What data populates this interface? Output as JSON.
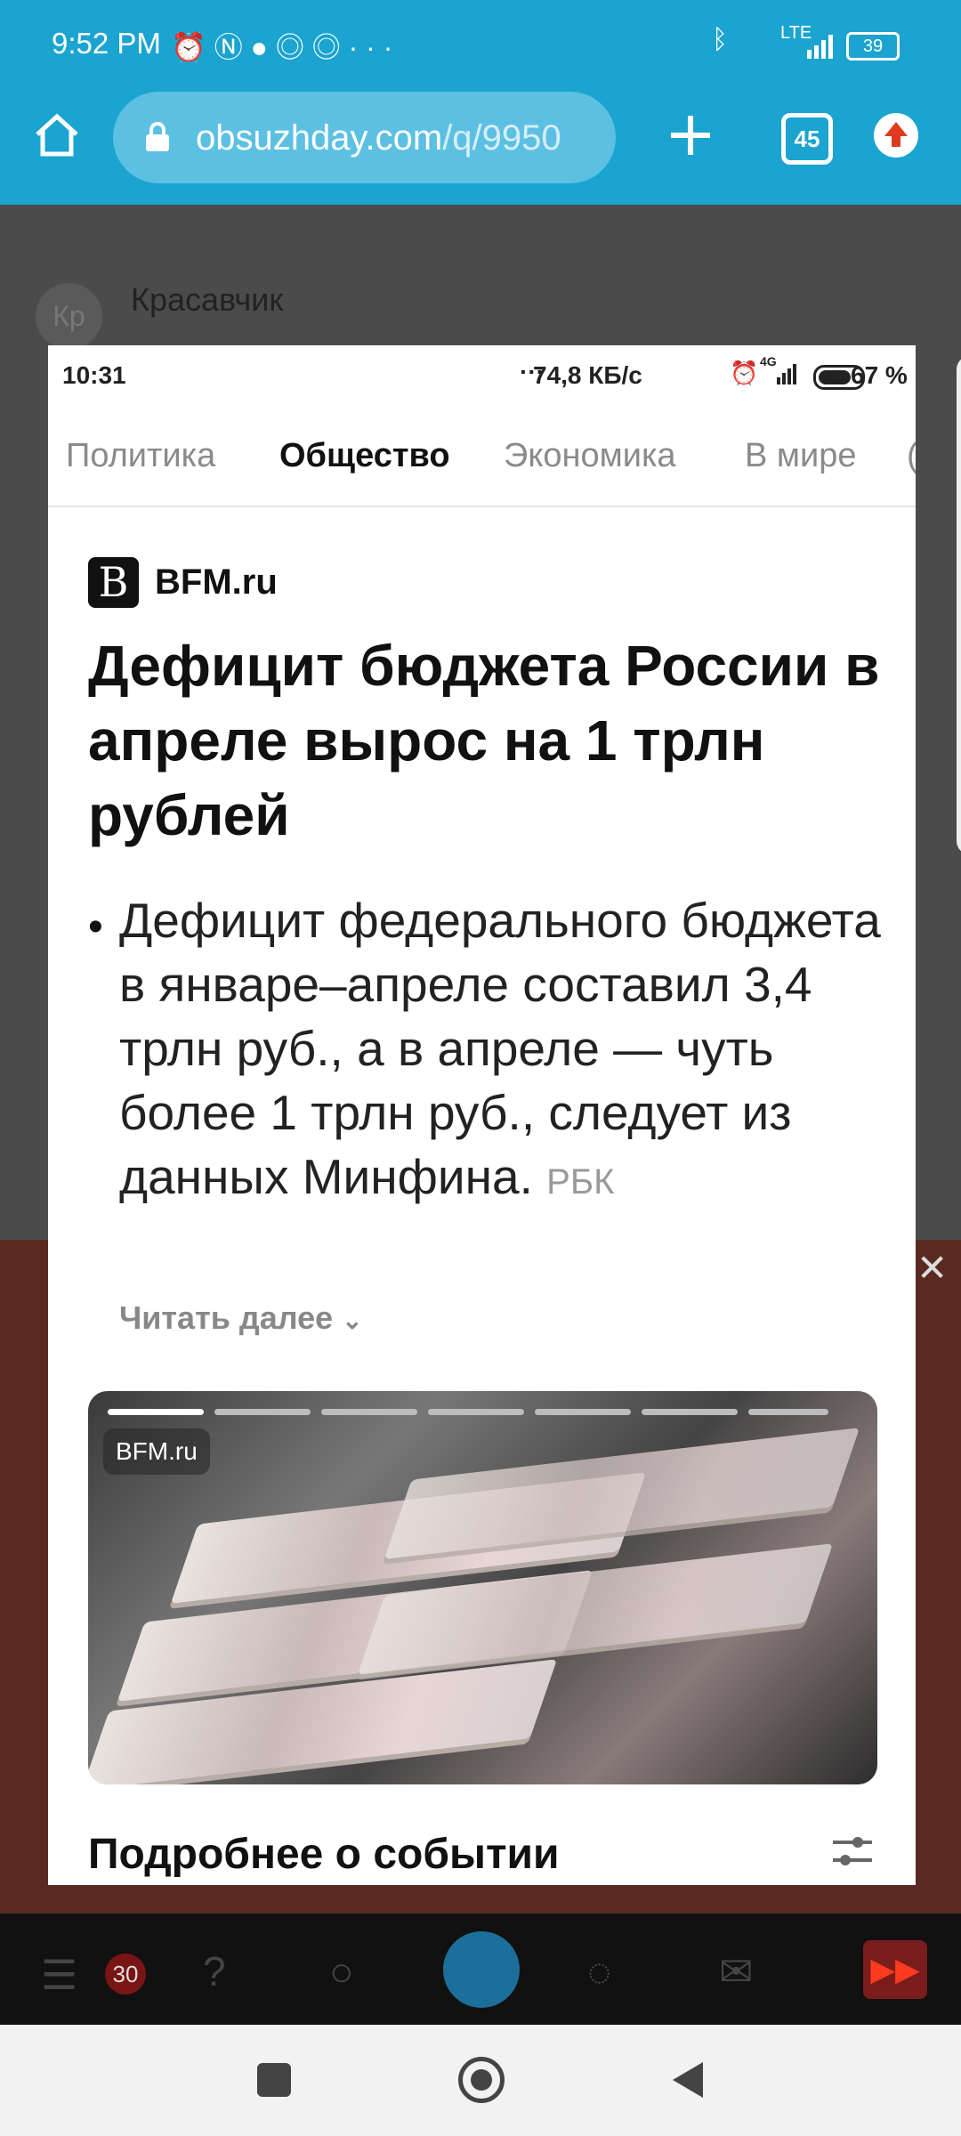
{
  "status_bar": {
    "time": "9:52 PM",
    "network": "LTE",
    "battery": "39"
  },
  "browser": {
    "url_host": "obsuzhday.com",
    "url_path": "/q/9950",
    "tab_count": "45"
  },
  "background_page": {
    "comment_avatar": "Кр",
    "comment_author": "Красавчик",
    "ad_close": "✕",
    "nav_badge": "30"
  },
  "screenshot": {
    "status": {
      "time": "10:31",
      "speed": "74,8 КБ/с",
      "network": "4G",
      "battery": "67 %"
    },
    "tabs": [
      {
        "label": "Политика",
        "active": false
      },
      {
        "label": "Общество",
        "active": true
      },
      {
        "label": "Экономика",
        "active": false
      },
      {
        "label": "В мире",
        "active": false
      }
    ],
    "source_logo": "B",
    "source_name": "BFM.ru",
    "headline": "Дефицит бюджета России в апреле вырос на 1 трлн рублей",
    "summary": "Дефицит федерального бюджета в январе–апреле составил 3,4 трлн руб., а в апреле — чуть более 1 трлн руб., следует из данных Минфина.",
    "summary_source": "РБК",
    "read_more": "Читать далее",
    "photo_label": "BFM.ru",
    "more_title": "Подробнее о событии"
  },
  "colors": {
    "browser_bar": "#1aa4cf",
    "url_pill": "#5cc0e2"
  }
}
